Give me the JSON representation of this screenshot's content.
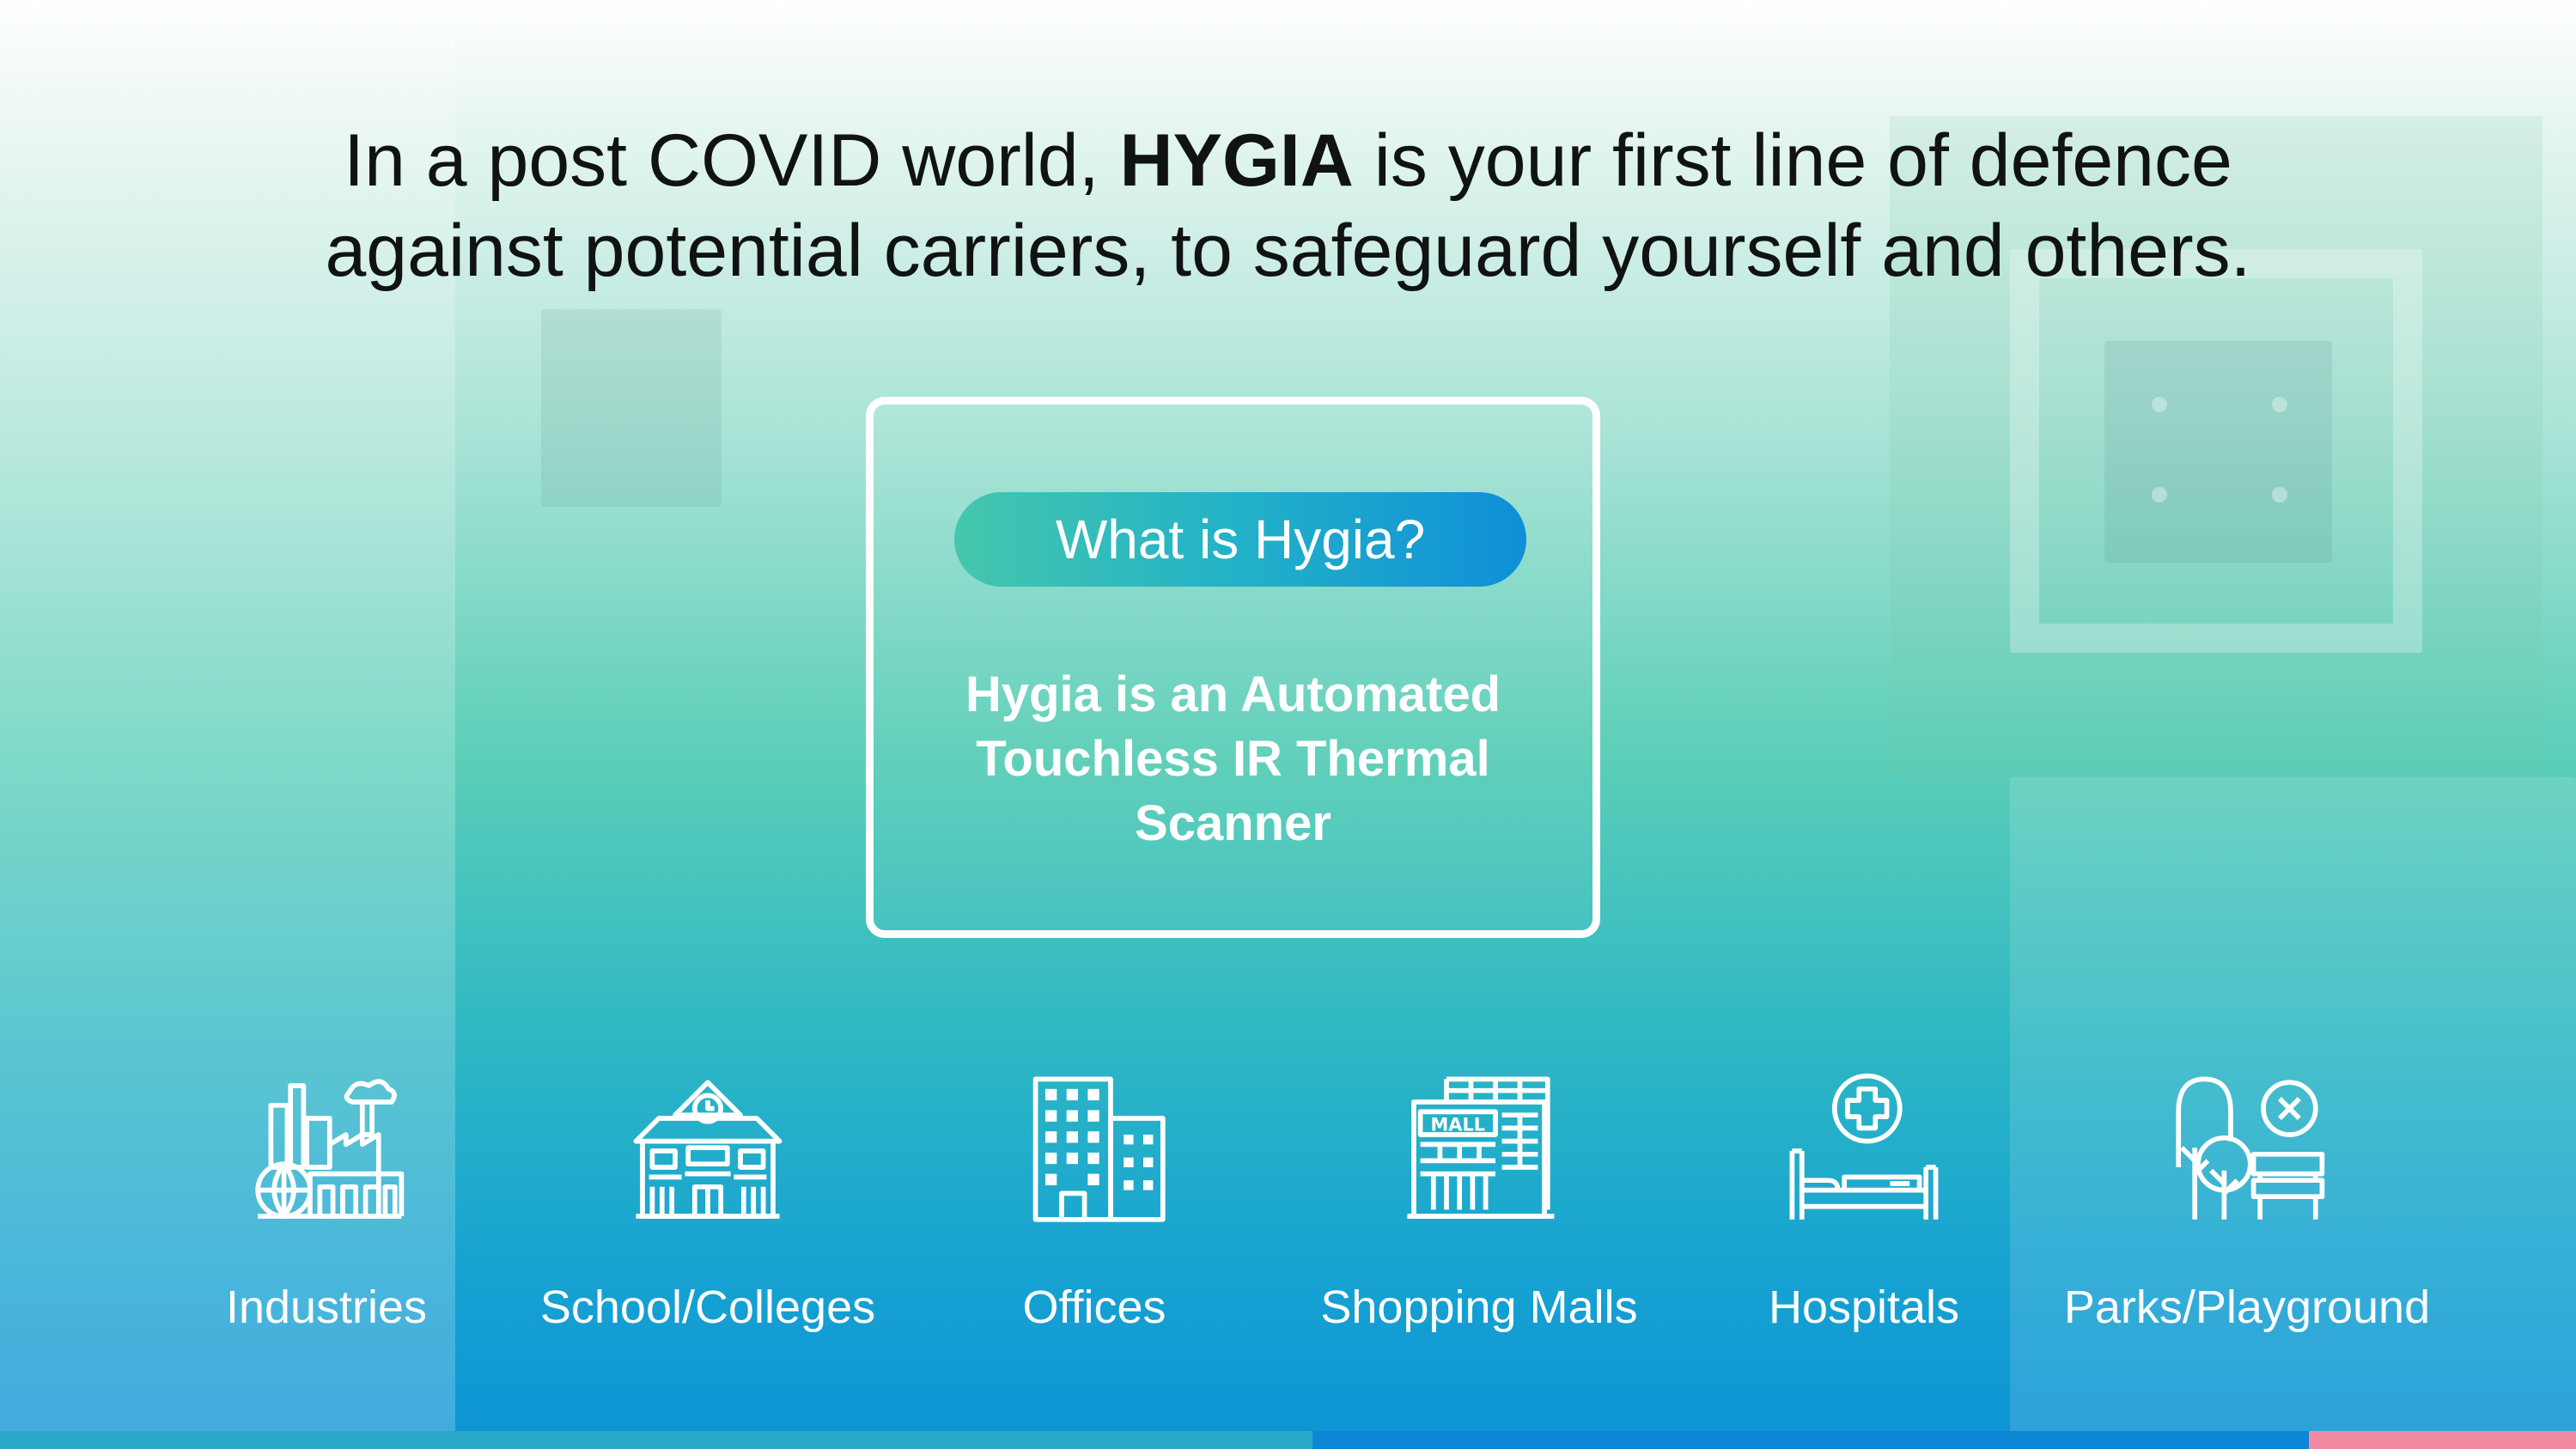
{
  "headline": {
    "pre": "In a post COVID world, ",
    "brand": "HYGIA",
    "post": " is your first line of defence",
    "line2": "against potential carriers, to safeguard yourself and others."
  },
  "card": {
    "pill_label": "What is Hygia?",
    "description": "Hygia is an Automated Touchless IR Thermal Scanner"
  },
  "venues": [
    {
      "label": "Industries",
      "icon": "factory-icon"
    },
    {
      "label": "School/Colleges",
      "icon": "school-icon"
    },
    {
      "label": "Offices",
      "icon": "office-building-icon"
    },
    {
      "label": "Shopping Malls",
      "icon": "mall-icon"
    },
    {
      "label": "Hospitals",
      "icon": "hospital-bed-icon"
    },
    {
      "label": "Parks/Playground",
      "icon": "park-icon"
    }
  ],
  "colors": {
    "pill_start": "#44c7ad",
    "pill_end": "#0f8fd7",
    "text_dark": "#101214",
    "bar_teal": "#2aa8c8",
    "bar_blue": "#0e86d6",
    "bar_pink": "#f08aa0"
  }
}
